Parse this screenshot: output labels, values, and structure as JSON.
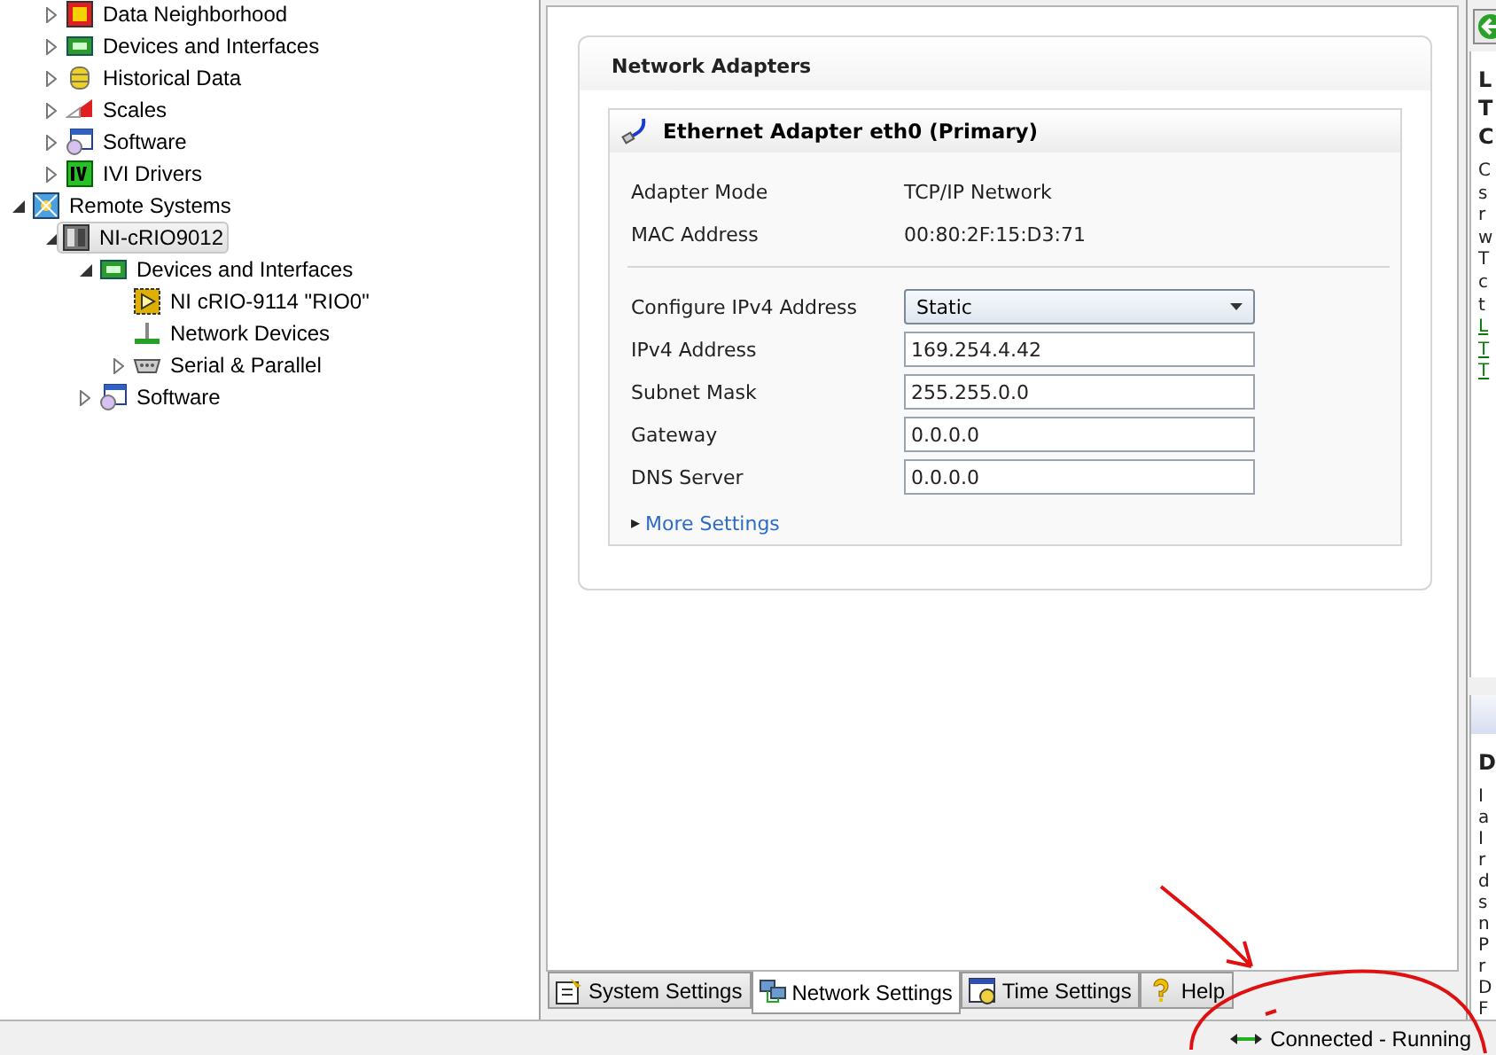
{
  "tree": {
    "scrolled_items": [
      {
        "label": "Data Neighborhood",
        "kind": "data",
        "expandable": true,
        "expanded": false,
        "selected": false
      },
      {
        "label": "Devices and Interfaces",
        "kind": "devices",
        "expandable": true,
        "expanded": false,
        "selected": false
      },
      {
        "label": "Historical Data",
        "kind": "historical",
        "expandable": true,
        "expanded": false,
        "selected": false
      },
      {
        "label": "Scales",
        "kind": "scales",
        "expandable": true,
        "expanded": false,
        "selected": false
      },
      {
        "label": "Software",
        "kind": "software",
        "expandable": true,
        "expanded": false,
        "selected": false
      },
      {
        "label": "IVI Drivers",
        "kind": "ivi",
        "expandable": true,
        "expanded": false,
        "selected": false
      }
    ],
    "items": [
      {
        "label": "Remote Systems",
        "kind": "remote",
        "expandable": true,
        "expanded": true,
        "selected": false,
        "children": [
          {
            "label": "NI-cRIO9012",
            "kind": "target",
            "expandable": true,
            "expanded": true,
            "selected": true,
            "children": [
              {
                "label": "Devices and Interfaces",
                "kind": "devices",
                "expandable": true,
                "expanded": true,
                "selected": false,
                "children": [
                  {
                    "label": "NI cRIO-9114 \"RIO0\"",
                    "kind": "module",
                    "expandable": false,
                    "selected": false
                  },
                  {
                    "label": "Network Devices",
                    "kind": "network",
                    "expandable": false,
                    "selected": false
                  },
                  {
                    "label": "Serial & Parallel",
                    "kind": "serial",
                    "expandable": true,
                    "expanded": false,
                    "selected": false
                  }
                ]
              },
              {
                "label": "Software",
                "kind": "software",
                "expandable": true,
                "expanded": false,
                "selected": false
              }
            ]
          }
        ]
      }
    ]
  },
  "panel": {
    "title": "Network Adapters",
    "adapter": {
      "title": "Ethernet Adapter eth0 (Primary)",
      "info": [
        {
          "label": "Adapter Mode",
          "value": "TCP/IP Network"
        },
        {
          "label": "MAC Address",
          "value": "00:80:2F:15:D3:71"
        }
      ],
      "fields": [
        {
          "kind": "select",
          "label": "Configure IPv4 Address",
          "value": "Static"
        },
        {
          "kind": "input",
          "label": "IPv4 Address",
          "value": "169.254.4.42"
        },
        {
          "kind": "input",
          "label": "Subnet Mask",
          "value": "255.255.0.0"
        },
        {
          "kind": "input",
          "label": "Gateway",
          "value": "0.0.0.0"
        },
        {
          "kind": "input",
          "label": "DNS Server",
          "value": "0.0.0.0"
        }
      ],
      "more": {
        "marker": "▸",
        "label": "More Settings",
        "expanded": false
      }
    }
  },
  "tabs": [
    {
      "label": "System Settings",
      "kind": "system",
      "selected": false
    },
    {
      "label": "Network Settings",
      "kind": "network",
      "selected": true
    },
    {
      "label": "Time Settings",
      "kind": "time",
      "selected": false
    },
    {
      "label": "Help",
      "kind": "help",
      "selected": false
    }
  ],
  "help_panel": {
    "title_lines": [
      "L",
      "T",
      "C"
    ],
    "body_lines": [
      "C",
      "s",
      "r",
      "w",
      "T",
      "c",
      "t"
    ],
    "links": [
      "L",
      "T",
      "T"
    ]
  },
  "details_panel": {
    "title": "D",
    "body_lines": [
      "I",
      "a",
      "I",
      "r",
      "d",
      "s",
      "n",
      "P",
      "r",
      "D",
      "F"
    ]
  },
  "status_bar": {
    "text": "Connected - Running"
  }
}
